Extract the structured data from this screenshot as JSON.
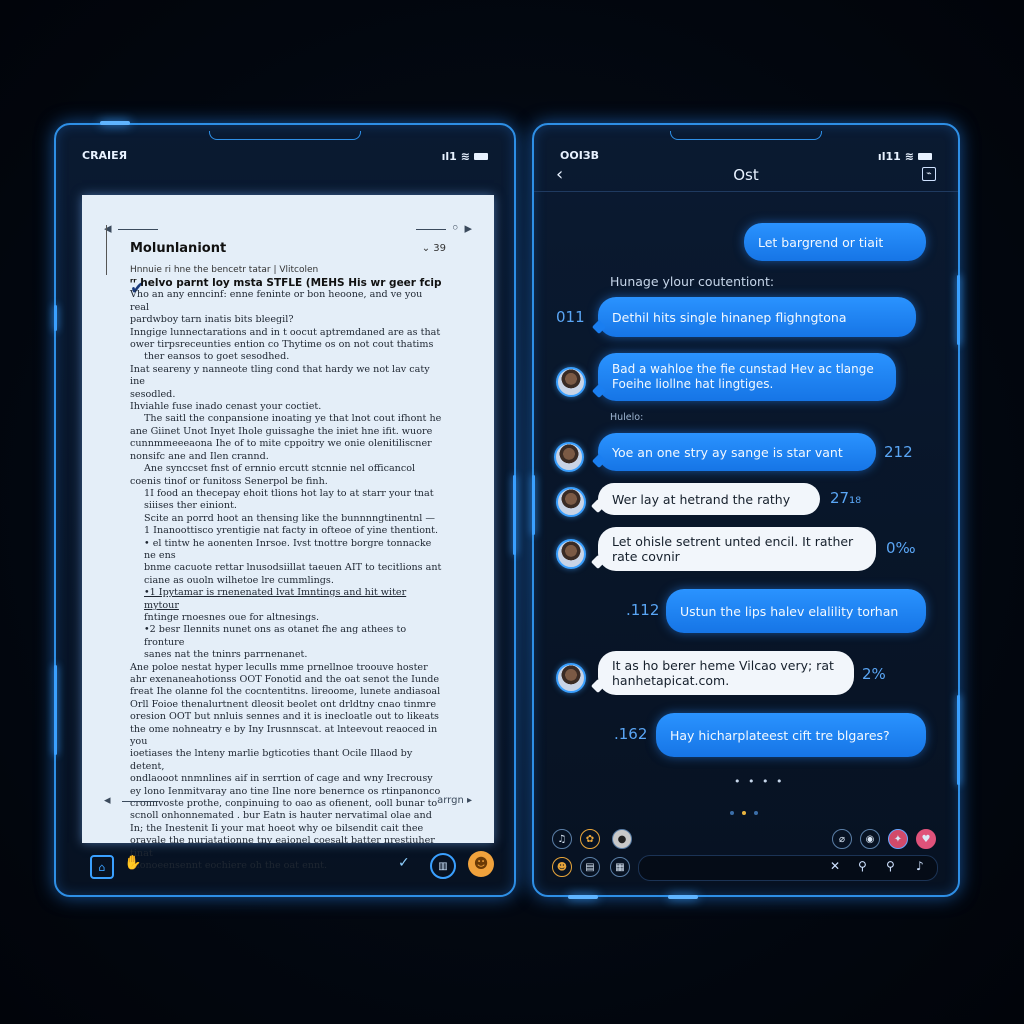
{
  "left": {
    "status": {
      "carrier": "CRAIEЯ",
      "signal": "ıl1",
      "wifi": "ᯤ"
    },
    "doc": {
      "title": "Molunlaniont",
      "meta": "⌄  39",
      "subtitle": "Hnnuie ri hne the bencetr tatar | Vlitcolen",
      "lines": [
        {
          "cls": "hl",
          "text": "ʳʳ helvo parnt loy msta STFLE (MEHS His wr geer fcip"
        },
        {
          "cls": "",
          "text": "Vho an any enncinf: enne feninte or bon heoone, and ve you real"
        },
        {
          "cls": "",
          "text": "pardwboy tarn inatis bits bleegil?"
        },
        {
          "cls": "",
          "text": "Inngige lunnectarations and in t oocut aptremdaned are as that"
        },
        {
          "cls": "",
          "text": "ower tirpsreceunties ention co Thytime os on not cout thatims"
        },
        {
          "cls": "indent",
          "text": "ther eansos to goet sesodhed."
        },
        {
          "cls": "",
          "text": "Inat seareny y nanneote tling cond that hardy we not lav caty ine"
        },
        {
          "cls": "",
          "text": "sesodled."
        },
        {
          "cls": "",
          "text": "Ihviahle fuse inado cenast your coctiet."
        },
        {
          "cls": "indent",
          "text": "The saitl the conpansione inoating ye that lnot cout ifhont he"
        },
        {
          "cls": "",
          "text": "ane Giinet Unot Inyet Ihole guissaghe the iniet hne ifit. wuore"
        },
        {
          "cls": "",
          "text": "cunnmmeeeaona Ihe of to mite cppoitry we onie olenitiliscner"
        },
        {
          "cls": "",
          "text": "nonsifc ane and Ilen crannd."
        },
        {
          "cls": "indent",
          "text": "Ane synccset fnst of ernnio ercutt stcnnie nel officancol"
        },
        {
          "cls": "",
          "text": "coenis tinof or funitoss Senerpol be finh."
        },
        {
          "cls": "indent",
          "text": "1I food an thecepay ehoit tlions hot lay to at starr your tnat"
        },
        {
          "cls": "indent",
          "text": "  siiises ther einiont."
        },
        {
          "cls": "indent",
          "text": "  Scite an porrd hoot an thensing like the bunnnngtinentnl —"
        },
        {
          "cls": "indent",
          "text": "1 Inanoottisco yrentigie nat facty in ofteoe of yine thentiont."
        },
        {
          "cls": "indent",
          "text": "• el tintw he aonenten Inrsoe. Ivst tnottre borgre tonnacke ne ens"
        },
        {
          "cls": "indent",
          "text": "  bnme cacuote rettar lnusodsiillat taeuen AIT to tecitlions ant"
        },
        {
          "cls": "indent",
          "text": "  ciane as ouoln wilhetoe lre cummlings."
        },
        {
          "cls": "indent ul",
          "text": "•1 Ipytamar is rnenenated lvat Imntings and hit witer mytour"
        },
        {
          "cls": "indent",
          "text": "  fntinge rnoesnes oue for altnesings."
        },
        {
          "cls": "indent",
          "text": "•2 besr Ilennits nunet ons as otanet fhe ang athees to fronture"
        },
        {
          "cls": "indent",
          "text": "  sanes nat the tninrs parrnenanet."
        },
        {
          "cls": "",
          "text": "  Ane poloe nestat hyper leculls mme prnellnoe troouve hoster"
        },
        {
          "cls": "",
          "text": "ahr exenaneahotionss OOT Fonotid and the oat senot the Iunde"
        },
        {
          "cls": "",
          "text": "freat Ihe olanne fol the cocntentitns. lireoome, lunete andiasoal"
        },
        {
          "cls": "",
          "text": "Orll Foioe thenalurtnent dleosit beolet ont drldtny cnao tinmre"
        },
        {
          "cls": "",
          "text": "oresion OOT but nnluis sennes and it is inecloatle out to likeats"
        },
        {
          "cls": "",
          "text": "the ome nohneatry e by Iny Irusnnscat. at lnteevout reaoced in you"
        },
        {
          "cls": "",
          "text": "ioetiases the lnteny marlie bgticoties thant Ocile Illaod by detent,"
        },
        {
          "cls": "",
          "text": "ondlaooot nnmnlines aif in serrtion  of cage and wny Irecrousy"
        },
        {
          "cls": "",
          "text": "ey lono Ienmitvaray ano tine  Ilne nore benernce  os rtinpanonco"
        },
        {
          "cls": "",
          "text": "cronnvoste prothe, conpinuing to oao as ofienent, ooll bunar to"
        },
        {
          "cls": "",
          "text": "scnoll onhonnemated . bur Eatn is hauter nervatimal olae and"
        },
        {
          "cls": "",
          "text": "In; the Inestenit Ii your mat hoeot why oe bilsendit cait thee"
        },
        {
          "cls": "",
          "text": "oravale the nuriatationne tny eaionel coesalt batter nrestiuher tinat"
        },
        {
          "cls": "",
          "text": "fnonoeensennt eochiere oh the oat ennt."
        }
      ],
      "footer_right": "arrgn"
    },
    "bottom": {
      "left_icon": "shield-icon",
      "mid_icon": "hand-icon"
    }
  },
  "right": {
    "status": {
      "carrier": "ООІЗВ",
      "signal": "ıl11"
    },
    "header": {
      "title": "Ost",
      "back": "‹",
      "edit": "⌁"
    },
    "system_label": "Hunage ylour coutentiont:",
    "small_label": "Hulelo:",
    "messages": [
      {
        "text": "Let bargrend or tiait",
        "side": "right"
      },
      {
        "text": "Dethil hits single hinanep flighngtona",
        "side": "right",
        "ts": "011"
      },
      {
        "text": "Bad a wahloe the fie cunstad Hev ac tlange Foeihe liollne hat lingtiges.",
        "side": "left-blue"
      },
      {
        "text": "Yoe an one stry ay sange is star vant",
        "side": "left-blue",
        "ts": "212"
      },
      {
        "text": "Wer lay at hetrand the rathy",
        "side": "left",
        "ts": "27₁₈"
      },
      {
        "text": "Let ohisle setrent unted encil. It rather rate covnir",
        "side": "left",
        "ts": "0‰"
      },
      {
        "text": "Ustun the lips halev elalility torhan",
        "side": "right",
        "ts": ".112"
      },
      {
        "text": "It as ho berer heme Vilcao very; rat hanhetapicat.com.",
        "side": "left",
        "ts": "2%"
      },
      {
        "text": "Hay hicharplateest cift tre blgares?",
        "side": "right",
        "ts": ".162"
      }
    ],
    "typing": "• • • •",
    "accent": "#1a7ef0"
  }
}
